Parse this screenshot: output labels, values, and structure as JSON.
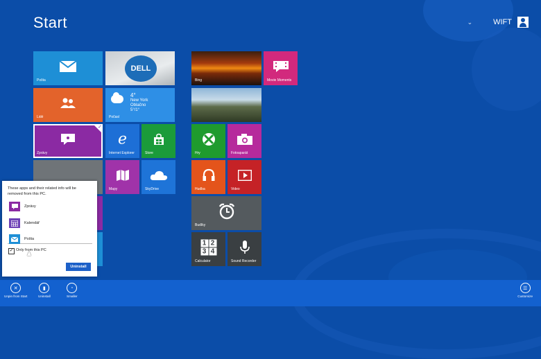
{
  "start": {
    "title": "Start"
  },
  "user": {
    "chevron": "⌄",
    "name": "WIFT"
  },
  "tiles": {
    "mail": {
      "label": "Pošta",
      "color": "#1e8fd6"
    },
    "dell": {
      "text": "DELL"
    },
    "people": {
      "label": "Lidé",
      "color": "#e3632b"
    },
    "weather": {
      "label": "Počasí",
      "temp": "4°",
      "city": "New York",
      "condition": "Oblačno",
      "range": "5°/1°",
      "color": "#2e8fe6"
    },
    "messaging": {
      "label": "Zprávy",
      "color": "#8b2aa3"
    },
    "ie": {
      "label": "Internet Explorer",
      "color": "#1d6fd6"
    },
    "store": {
      "label": "Store",
      "color": "#1b9b3a"
    },
    "maps": {
      "label": "Mapy",
      "color": "#a033a9"
    },
    "skydrive": {
      "label": "SkyDrive",
      "color": "#1e74d8"
    },
    "bing": {
      "label": "Bing"
    },
    "movie": {
      "label": "Movie Moments",
      "color": "#d2297d"
    },
    "travel": {
      "label": ""
    },
    "games": {
      "label": "Hry",
      "color": "#1f9b2e"
    },
    "camera": {
      "label": "Fotoaparát",
      "color": "#b62a9c"
    },
    "music": {
      "label": "Hudba",
      "color": "#e4541b"
    },
    "video": {
      "label": "Video",
      "color": "#c52226"
    },
    "alarms": {
      "label": "Budíky",
      "color": "#545a5e"
    },
    "calculator": {
      "label": "Calculator",
      "digits": [
        "1",
        "2",
        "3",
        "4"
      ],
      "color": "#3a3f42"
    },
    "sound": {
      "label": "Sound Recorder",
      "color": "#3a3f42"
    }
  },
  "uninstall_panel": {
    "message": "These apps and their related info will be removed from this PC.",
    "apps": [
      {
        "name": "Zprávy",
        "color": "#8b2aa3",
        "icon": "messaging-icon"
      },
      {
        "name": "Kalendář",
        "color": "#6d3fb5",
        "icon": "calendar-icon"
      },
      {
        "name": "Pošta",
        "color": "#1e8fd6",
        "icon": "mail-icon"
      }
    ],
    "checkbox_label": "Only from this PC",
    "checkbox_checked": true,
    "button": "Uninstall"
  },
  "appbar": {
    "unpin": "Unpin from Start",
    "uninstall": "Uninstall",
    "smaller": "Smaller",
    "customize": "Customize"
  }
}
